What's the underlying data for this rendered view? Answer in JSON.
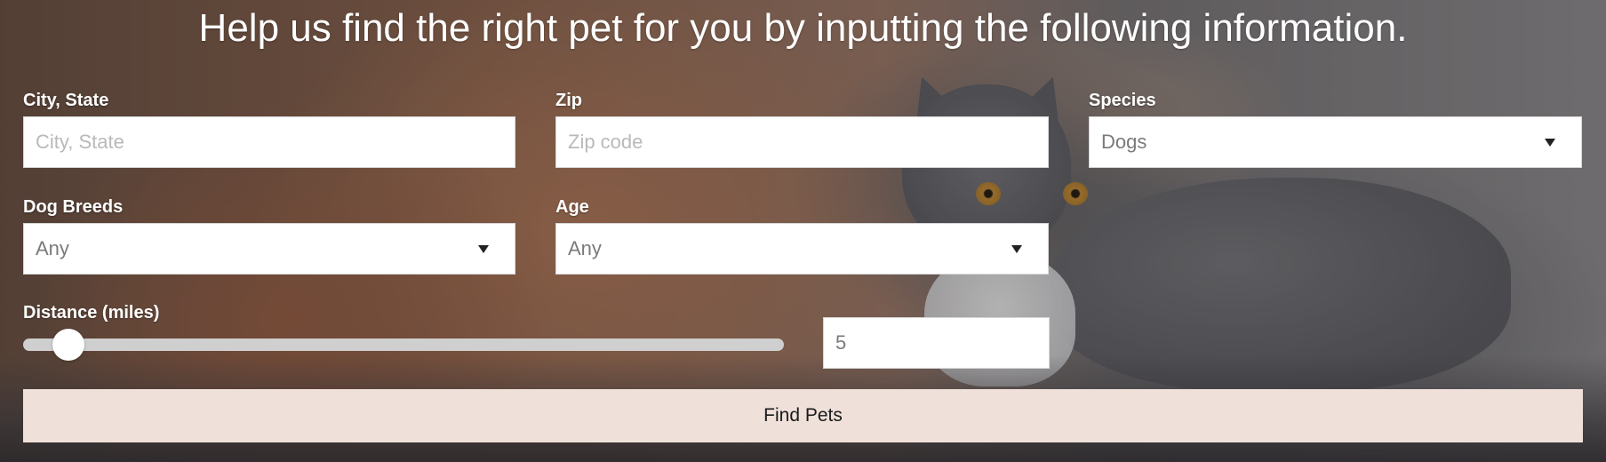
{
  "headline": "Help us find the right pet for you by inputting the following information.",
  "form": {
    "city_state": {
      "label": "City, State",
      "placeholder": "City, State",
      "value": ""
    },
    "zip": {
      "label": "Zip",
      "placeholder": "Zip code",
      "value": ""
    },
    "species": {
      "label": "Species",
      "selected": "Dogs"
    },
    "dog_breeds": {
      "label": "Dog Breeds",
      "selected": "Any"
    },
    "age": {
      "label": "Age",
      "selected": "Any"
    },
    "distance": {
      "label": "Distance (miles)",
      "value": "5",
      "min": 0,
      "max": 100,
      "slider_fraction": 0.04
    },
    "submit_label": "Find Pets"
  },
  "colors": {
    "button_bg": "#efe0da",
    "label_text": "#ffffff",
    "slider_track": "#cfcfcf"
  },
  "icons": {
    "select_caret": "chevron-down-icon"
  }
}
